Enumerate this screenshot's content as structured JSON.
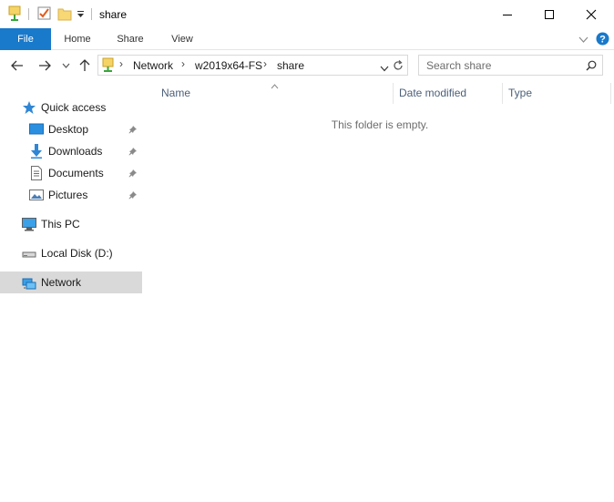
{
  "window": {
    "title": "share",
    "controls": [
      "minimize-icon",
      "maximize-icon",
      "close-icon"
    ]
  },
  "quick_access_toolbar": {
    "icons": [
      "properties-icon",
      "checkmark-icon",
      "new-folder-icon",
      "customize-dropdown-icon"
    ]
  },
  "ribbon": {
    "tabs": [
      {
        "label": "File",
        "active": true
      },
      {
        "label": "Home"
      },
      {
        "label": "Share"
      },
      {
        "label": "View"
      }
    ],
    "accent_color": "#1979ca",
    "right_icons": [
      "expand-ribbon-icon",
      "help-icon"
    ]
  },
  "navigation": {
    "buttons": [
      "back-arrow-icon",
      "forward-arrow-icon",
      "recent-locations-icon",
      "up-arrow-icon"
    ],
    "breadcrumb": [
      "Network",
      "w2019x64-FS",
      "share"
    ],
    "search_placeholder": "Search share"
  },
  "sidebar": {
    "items": [
      {
        "label": "Quick access",
        "icon": "star-icon"
      },
      {
        "label": "Desktop",
        "icon": "desktop-icon",
        "pinned": true
      },
      {
        "label": "Downloads",
        "icon": "downloads-icon",
        "pinned": true
      },
      {
        "label": "Documents",
        "icon": "documents-icon",
        "pinned": true
      },
      {
        "label": "Pictures",
        "icon": "pictures-icon",
        "pinned": true
      },
      {
        "label": "This PC",
        "icon": "computer-icon"
      },
      {
        "label": "Local Disk (D:)",
        "icon": "drive-icon"
      },
      {
        "label": "Network",
        "icon": "network-icon",
        "selected": true
      }
    ]
  },
  "file_list": {
    "columns": [
      "Name",
      "Date modified",
      "Type"
    ],
    "empty_message": "This folder is empty."
  }
}
